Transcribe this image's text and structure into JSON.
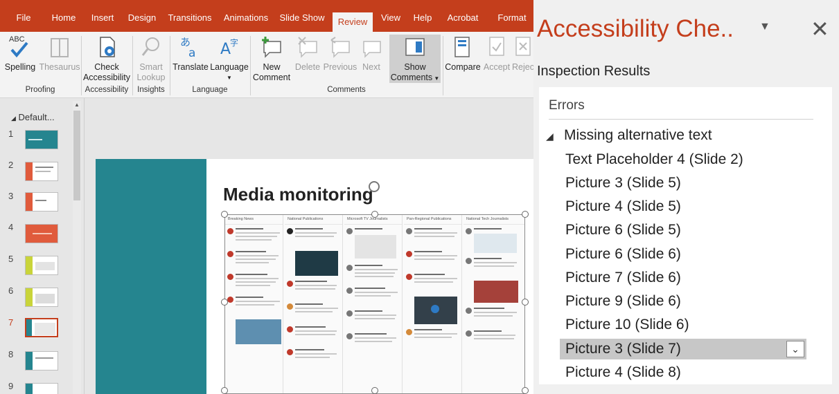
{
  "ribbon": {
    "tabs": [
      "File",
      "Home",
      "Insert",
      "Design",
      "Transitions",
      "Animations",
      "Slide Show",
      "Review",
      "View",
      "Help",
      "Acrobat",
      "Format"
    ],
    "active_tab": "Review",
    "buttons": {
      "spelling": {
        "icon_label": "ABC",
        "label": "Spelling"
      },
      "thesaurus": "Thesaurus",
      "check_accessibility": [
        "Check",
        "Accessibility"
      ],
      "smart_lookup": [
        "Smart",
        "Lookup"
      ],
      "translate": "Translate",
      "language": "Language",
      "new_comment": [
        "New",
        "Comment"
      ],
      "delete": "Delete",
      "previous": "Previous",
      "next": "Next",
      "show_comments": [
        "Show",
        "Comments"
      ],
      "compare": "Compare",
      "accept": "Accept",
      "reject": "Rejec"
    },
    "groups": {
      "proofing": "Proofing",
      "accessibility": "Accessibility",
      "insights": "Insights",
      "language": "Language",
      "comments": "Comments"
    }
  },
  "thumbnails": {
    "section_name": "Default...",
    "slides": [
      "1",
      "2",
      "3",
      "4",
      "5",
      "6",
      "7",
      "8",
      "9"
    ],
    "active_slide": "7"
  },
  "slide": {
    "title": "Media monitoring",
    "columns": [
      "Breaking News",
      "National Publications",
      "Microsoft TV Journalists",
      "Pan-Regional Publications",
      "National Tech Journalists"
    ]
  },
  "pane": {
    "title": "Accessibility Che..",
    "menu_icon": "dropdown-arrow",
    "close_icon": "close-x",
    "inspection_results": "Inspection Results",
    "errors_header": "Errors",
    "category": "Missing alternative text",
    "items": [
      "Text Placeholder 4  (Slide 2)",
      "Picture 3  (Slide 5)",
      "Picture 4  (Slide 5)",
      "Picture 6  (Slide 5)",
      "Picture 6  (Slide 6)",
      "Picture 7  (Slide 6)",
      "Picture 9  (Slide 6)",
      "Picture 10  (Slide 6)",
      "Picture 3  (Slide 7)",
      "Picture 4  (Slide 8)"
    ],
    "selected_item": "Picture 3  (Slide 7)"
  },
  "colors": {
    "accent": "#c43e1c",
    "slide_band": "#25858f"
  }
}
